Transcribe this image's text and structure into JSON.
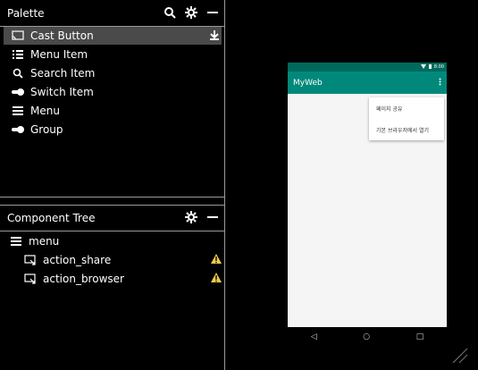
{
  "palette": {
    "title": "Palette",
    "items": [
      {
        "label": "Cast Button",
        "icon": "cast-icon",
        "selected": true
      },
      {
        "label": "Menu Item",
        "icon": "menu-item-icon"
      },
      {
        "label": "Search Item",
        "icon": "search-icon"
      },
      {
        "label": "Switch Item",
        "icon": "switch-icon"
      },
      {
        "label": "Menu",
        "icon": "menu-icon"
      },
      {
        "label": "Group",
        "icon": "group-icon"
      }
    ]
  },
  "component_tree": {
    "title": "Component Tree",
    "root": "menu",
    "children": [
      {
        "label": "action_share",
        "warning": true
      },
      {
        "label": "action_browser",
        "warning": true
      }
    ]
  },
  "preview": {
    "status_time": "8:00",
    "app_title": "MyWeb",
    "overflow_menu": [
      "페이지 공유",
      "기본 브라우저에서 열기"
    ],
    "nav": [
      "◁",
      "○",
      "□"
    ]
  },
  "colors": {
    "primary_dark": "#00695c",
    "primary": "#00897b",
    "warning": "#f2c94c"
  }
}
